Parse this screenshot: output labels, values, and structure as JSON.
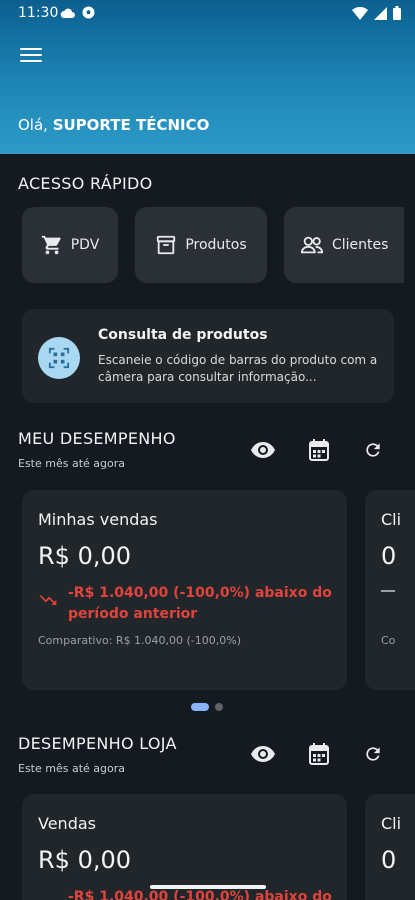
{
  "status_bar": {
    "time": "11:30"
  },
  "header": {
    "greeting_prefix": "Olá, ",
    "user_name": "SUPORTE TÉCNICO"
  },
  "quick_access": {
    "title": "ACESSO RÁPIDO",
    "items": [
      {
        "label": "PDV",
        "icon": "cart-icon"
      },
      {
        "label": "Produtos",
        "icon": "archive-box-icon"
      },
      {
        "label": "Clientes",
        "icon": "people-icon"
      }
    ]
  },
  "consulta": {
    "title": "Consulta de produtos",
    "description": "Escaneie o código de barras do produto com a câmera para consultar informação..."
  },
  "meu_desempenho": {
    "title": "MEU DESEMPENHO",
    "subtitle": "Este mês até agora",
    "cards": [
      {
        "title": "Minhas vendas",
        "value": "R$ 0,00",
        "diff": "-R$ 1.040,00 (-100,0%) abaixo do período anterior",
        "comparativo": "Comparativo: R$ 1.040,00 (-100,0%)"
      },
      {
        "title": "Cli",
        "value": "0",
        "comparativo": "Co"
      }
    ],
    "pager": {
      "count": 2,
      "active": 0
    }
  },
  "desempenho_loja": {
    "title": "DESEMPENHO LOJA",
    "subtitle": "Este mês até agora",
    "cards": [
      {
        "title": "Vendas",
        "value": "R$ 0,00",
        "diff": "-R$ 1.040,00 (-100,0%) abaixo do"
      },
      {
        "title": "Cli",
        "value": "0"
      }
    ]
  },
  "colors": {
    "accent_header": "#1e86b6",
    "negative": "#e0443c",
    "card_bg": "#21262b"
  }
}
